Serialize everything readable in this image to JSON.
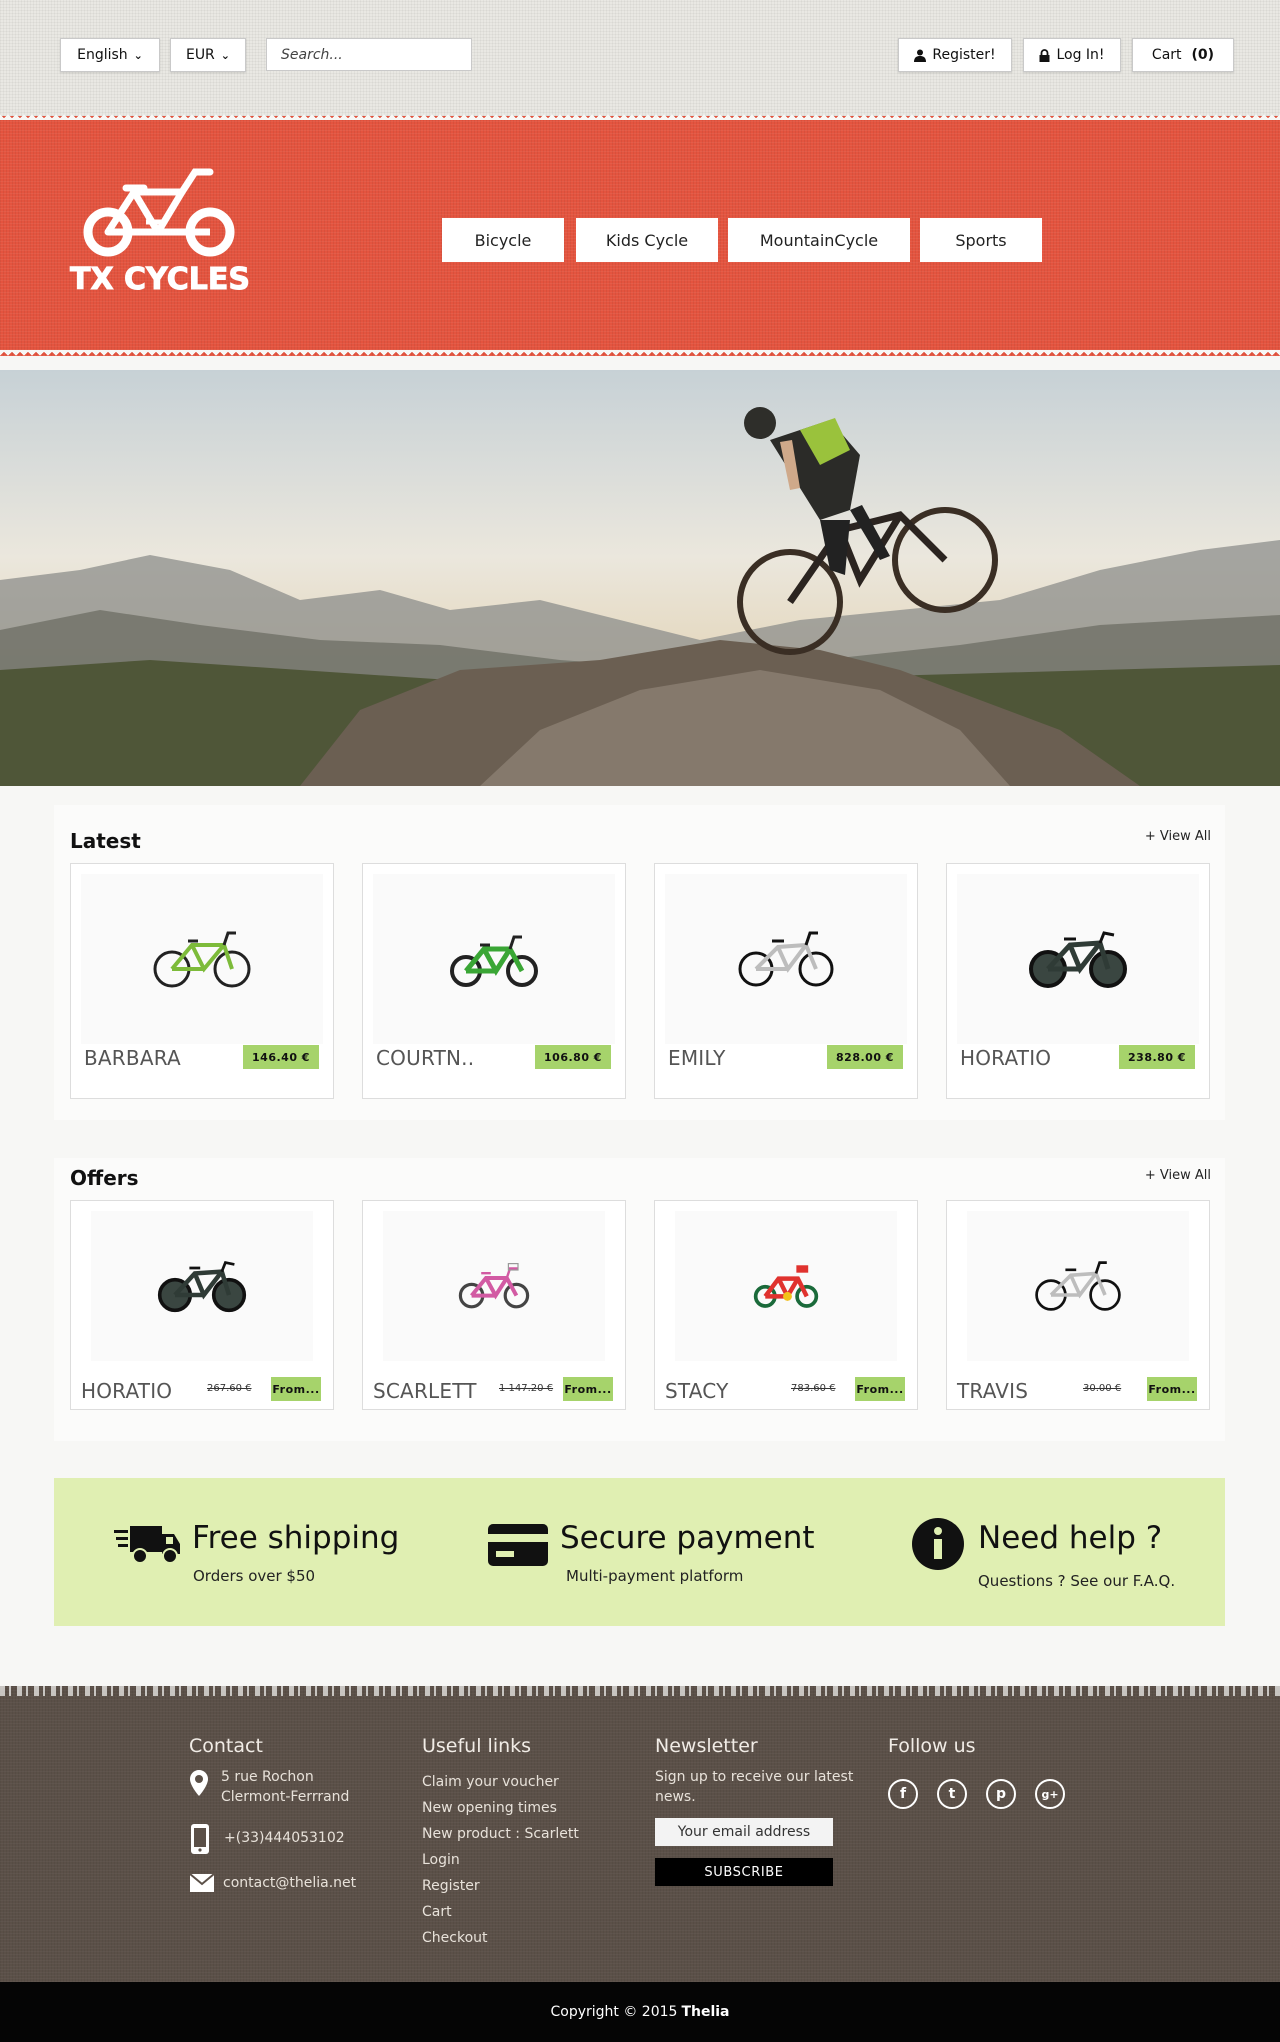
{
  "topbar": {
    "language": "English",
    "currency": "EUR",
    "search_placeholder": "Search...",
    "register_label": "Register!",
    "login_label": "Log In!",
    "cart_label": "Cart",
    "cart_count": "(0)"
  },
  "header": {
    "logo_text": "TX CYCLES",
    "nav": [
      "Bicycle",
      "Kids Cycle",
      "MountainCycle",
      "Sports"
    ]
  },
  "latest": {
    "title": "Latest",
    "view_all": "+ View All",
    "products": [
      {
        "name": "BARBARA",
        "price": "146.40 €",
        "color": "#7dbb3a"
      },
      {
        "name": "COURTN..",
        "price": "106.80 €",
        "color": "#3aa635"
      },
      {
        "name": "EMILY",
        "price": "828.00 €",
        "color": "#c8c8c8"
      },
      {
        "name": "HORATIO",
        "price": "238.80 €",
        "color": "#2f3b36"
      }
    ]
  },
  "offers": {
    "title": "Offers",
    "view_all": "+ View All",
    "products": [
      {
        "name": "HORATIO",
        "old_price": "267.60 €",
        "tag": "From...",
        "color": "#2f3b36"
      },
      {
        "name": "SCARLETT",
        "old_price": "1 147.20 €",
        "tag": "From...",
        "color": "#d25aa3"
      },
      {
        "name": "STACY",
        "old_price": "783.60 €",
        "tag": "From...",
        "color": "#e0322e"
      },
      {
        "name": "TRAVIS",
        "old_price": "30.00 €",
        "tag": "From...",
        "color": "#bdbdbd"
      }
    ]
  },
  "features": [
    {
      "title": "Free shipping",
      "subtitle": "Orders over $50",
      "icon": "truck-icon"
    },
    {
      "title": "Secure payment",
      "subtitle": "Multi-payment platform",
      "icon": "credit-card-icon"
    },
    {
      "title": "Need help ?",
      "subtitle": "Questions ? See our F.A.Q.",
      "icon": "info-icon"
    }
  ],
  "footer": {
    "contact": {
      "title": "Contact",
      "address_line1": "5 rue Rochon",
      "address_line2": "Clermont-Ferrrand",
      "phone": "+(33)444053102",
      "email": "contact@thelia.net"
    },
    "links": {
      "title": "Useful links",
      "items": [
        "Claim your voucher",
        "New opening times",
        "New product : Scarlett",
        "Login",
        "Register",
        "Cart",
        "Checkout"
      ]
    },
    "newsletter": {
      "title": "Newsletter",
      "text": "Sign up to receive our latest news.",
      "email_placeholder": "Your email address",
      "subscribe_label": "SUBSCRIBE"
    },
    "follow": {
      "title": "Follow us",
      "icons": [
        "f",
        "t",
        "p",
        "g+"
      ]
    }
  },
  "copyright": {
    "text": "Copyright ©  2015",
    "brand": "Thelia"
  }
}
